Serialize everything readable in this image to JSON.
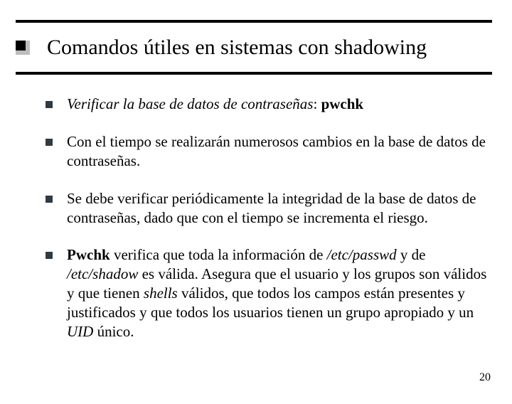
{
  "title": "Comandos útiles en sistemas con shadowing",
  "bullets": {
    "b1_lead": "Verificar la base de datos de contraseñas",
    "b1_sep": ": ",
    "b1_cmd": "pwchk",
    "b2": "Con el tiempo se realizarán numerosos cambios en la base de datos de contraseñas.",
    "b3": "Se debe verificar periódicamente la integridad de la base de datos de contraseñas, dado que con el tiempo se incrementa el riesgo.",
    "b4_a": "Pwchk",
    "b4_b": " verifica que toda la información de ",
    "b4_c": "/etc/passwd",
    "b4_d": " y de ",
    "b4_e": "/etc/shadow",
    "b4_f": " es válida. Asegura que el usuario y los grupos son válidos y que tienen ",
    "b4_g": "shells",
    "b4_h": " válidos, que todos los campos están presentes y justificados y que todos los usuarios tienen un grupo apropiado y un ",
    "b4_i": "UID",
    "b4_j": " único."
  },
  "page_number": "20"
}
